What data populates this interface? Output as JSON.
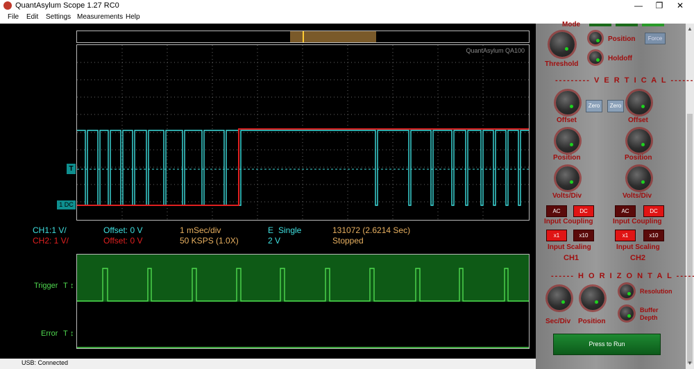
{
  "window": {
    "title": "QuantAsylum Scope 1.27 RC0",
    "minimize": "—",
    "maximize": "❐",
    "close": "✕"
  },
  "menu": {
    "file": "File",
    "edit": "Edit",
    "settings": "Settings",
    "measurements": "Measurements",
    "help": "Help"
  },
  "scope": {
    "brand": "QuantAsylum QA100",
    "trigger_marker": "T",
    "coupling_marker": "1 DC",
    "colors": {
      "ch1": "#3fe0e0",
      "ch2": "#e02020",
      "grid": "#666666",
      "trigger": "#4fd94f"
    }
  },
  "readout": {
    "ch1": "CH1:1 V/",
    "ch2": "CH2: 1 V/",
    "offset1": "Offset: 0 V",
    "offset2": "Offset: 0 V",
    "timebase": "1 mSec/div",
    "samplerate": "50 KSPS (1.0X)",
    "trig_label": "E",
    "trig_mode": "Single",
    "trig_level": "2 V",
    "samples": "131072 (2.6214 Sec)",
    "state": "Stopped"
  },
  "digital": {
    "trigger_label": "Trigger",
    "trigger_t": "T",
    "error_label": "Error",
    "error_t": "T",
    "updown": "↕"
  },
  "panel": {
    "mode": "Mode",
    "threshold": "Threshold",
    "position": "Position",
    "holdoff": "Holdoff",
    "force": "Force",
    "vertical": "--------- V E R T I C A L ---------",
    "zero": "Zero",
    "offset": "Offset",
    "position_v": "Position",
    "volts_div": "Volts/Div",
    "ac": "AC",
    "dc": "DC",
    "input_coupling": "Input Coupling",
    "x1": "x1",
    "x10": "x10",
    "input_scaling": "Input Scaling",
    "ch1": "CH1",
    "ch2": "CH2",
    "horizontal": "------ H O R I Z O N T A L ------",
    "resolution": "Resolution",
    "buffer": "Buffer",
    "depth": "Depth",
    "sec_div": "Sec/Div",
    "h_position": "Position",
    "run": "Press to Run"
  },
  "status": {
    "usb": "USB: Connected"
  }
}
